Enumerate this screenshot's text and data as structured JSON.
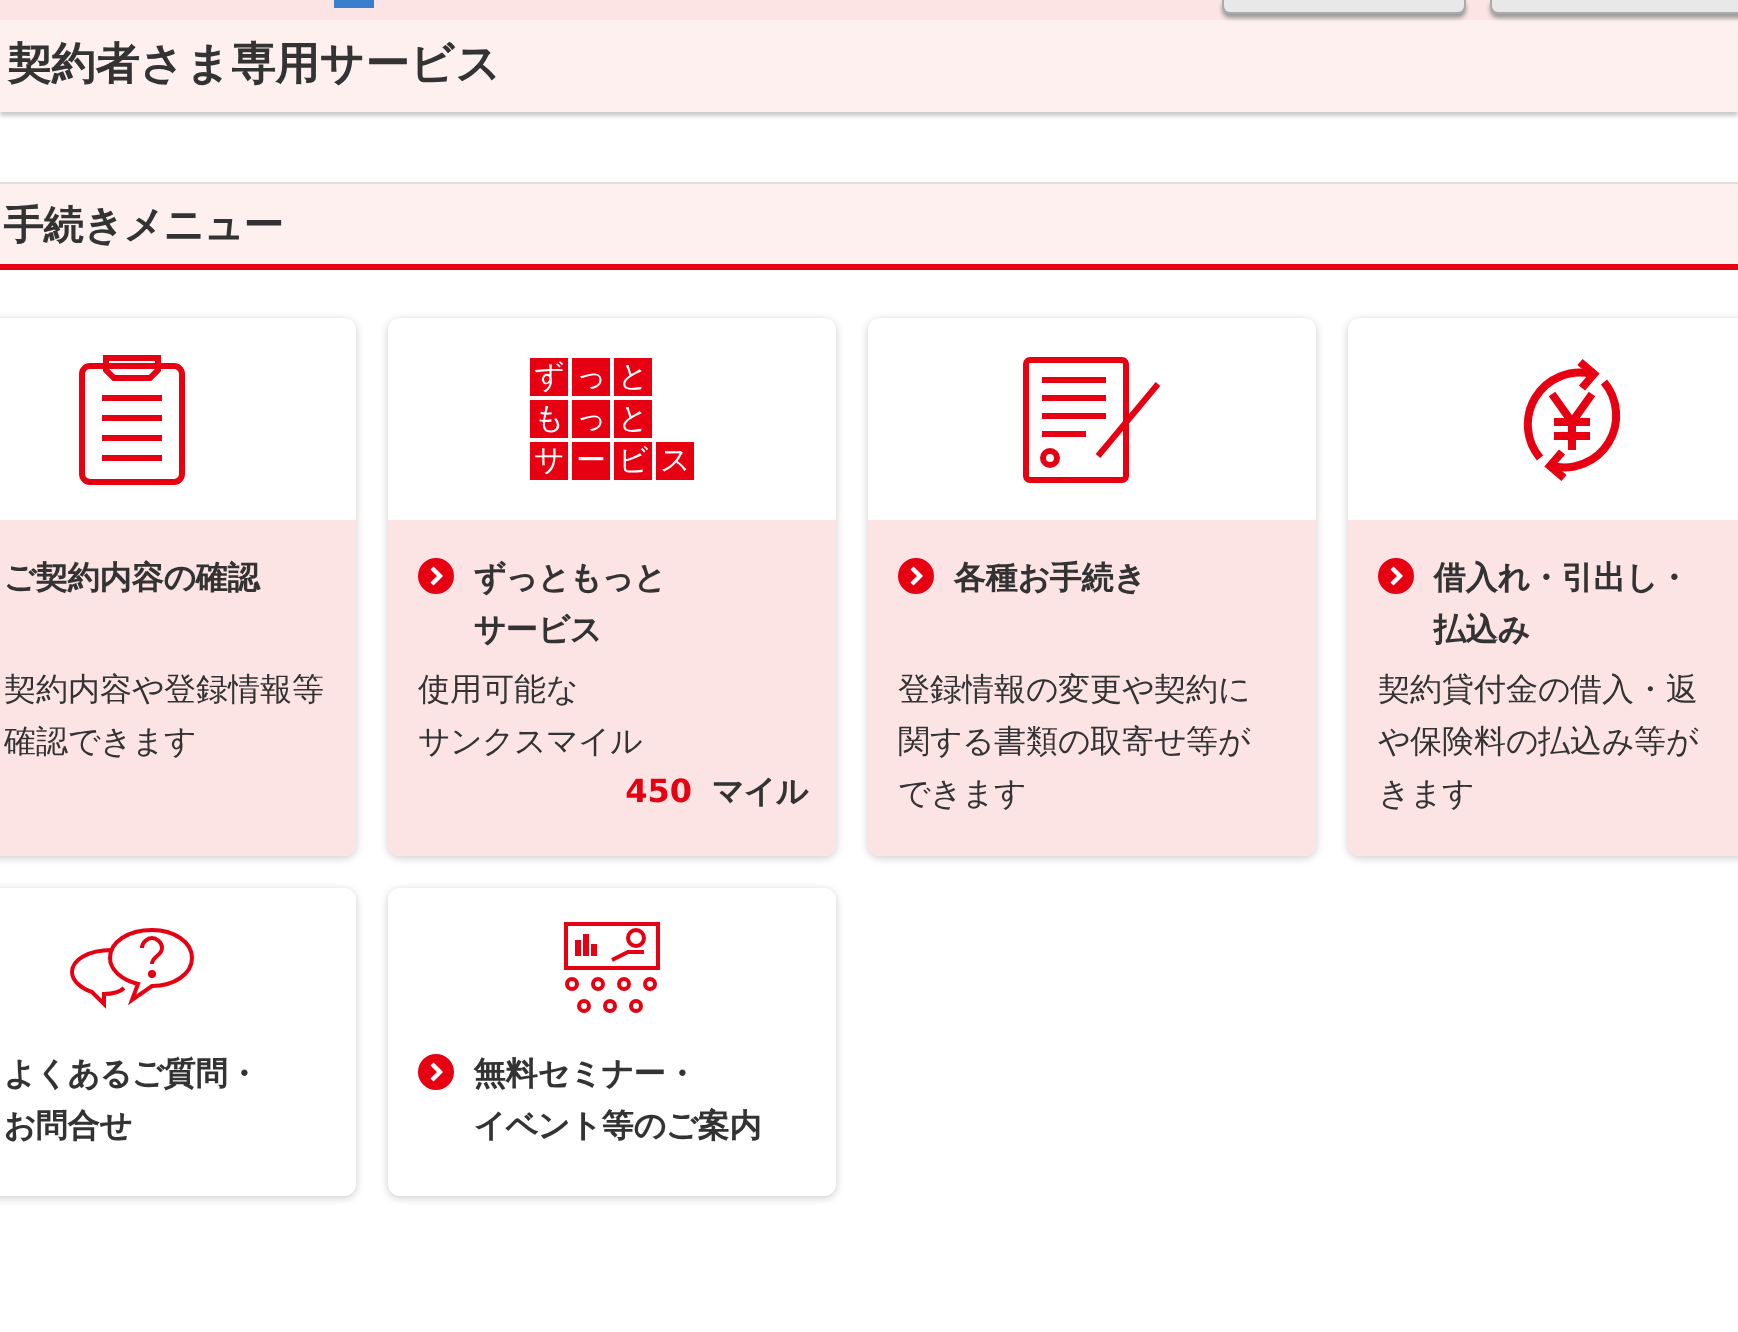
{
  "page_title": "契約者さま専用サービス",
  "section_title": "手続きメニュー",
  "menu_cards": [
    {
      "kind": "pink",
      "chevron": false,
      "title": [
        "ご契約内容の確認"
      ],
      "description": [
        "契約内容や登録情報等",
        "確認できます"
      ]
    },
    {
      "kind": "pink",
      "logo": [
        "ずっと",
        "もっと",
        "サービス"
      ],
      "chevron": true,
      "title": [
        "ずっともっと",
        "サービス"
      ],
      "description": [
        "使用可能な",
        "サンクスマイル"
      ],
      "points": {
        "value": "450",
        "unit": "マイル"
      }
    },
    {
      "kind": "pink",
      "chevron": true,
      "title": [
        "各種お手続き"
      ],
      "description": [
        "登録情報の変更や契約に",
        "関する書類の取寄せ等が",
        "できます"
      ]
    },
    {
      "kind": "pink",
      "chevron": true,
      "title": [
        "借入れ・引出し・",
        "払込み"
      ],
      "description": [
        "契約貸付金の借入・返",
        "や保険料の払込み等が",
        "きます"
      ]
    },
    {
      "kind": "white",
      "chevron": false,
      "title": [
        "よくあるご質問・",
        "お問合せ"
      ]
    },
    {
      "kind": "white",
      "chevron": true,
      "title": [
        "無料セミナー・",
        "イベント等のご案内"
      ]
    }
  ]
}
